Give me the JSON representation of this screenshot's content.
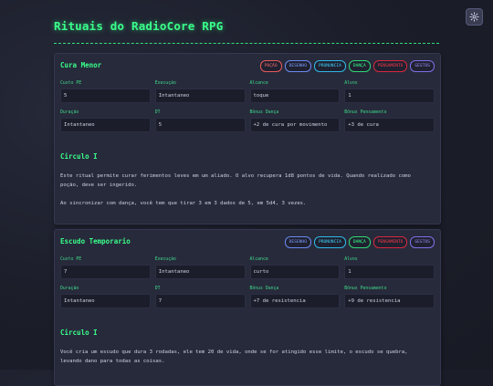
{
  "page_title": "Rituais do RadioCore RPG",
  "settings_icon": "gear-icon",
  "rituals": [
    {
      "name": "Cura Menor",
      "tags": [
        "POÇÃO",
        "DESENHO",
        "PRONUNCIA",
        "DANÇA",
        "PENSAMENTO",
        "GESTOS"
      ],
      "fields": [
        {
          "label": "Custo PE",
          "value": "5"
        },
        {
          "label": "Execução",
          "value": "Intantaneo"
        },
        {
          "label": "Alcance",
          "value": "toque"
        },
        {
          "label": "Alvos",
          "value": "1"
        },
        {
          "label": "Duração",
          "value": "Intantaneo"
        },
        {
          "label": "DT",
          "value": "5"
        },
        {
          "label": "Bônus Dança",
          "value": "+2 de cura por movimento"
        },
        {
          "label": "Bônus Pensamento",
          "value": "+3 de cura"
        }
      ],
      "circle": "Circulo I",
      "description": "Este ritual permite curar ferimentos leves em um aliado. O alvo recupera 1d8 pontos de vida. Quando realizado como poção, deve ser ingerido.",
      "note": "Ao sincronizar com dança, você tem que tirar 3 em 3 dados de 5, em 5d4, 3 vezes."
    },
    {
      "name": "Escudo Temporario",
      "tags": [
        "DESENHO",
        "PRONUNCIA",
        "DANÇA",
        "PENSAMENTO",
        "GESTOS"
      ],
      "fields": [
        {
          "label": "Custo PE",
          "value": "7"
        },
        {
          "label": "Execução",
          "value": "Intantaneo"
        },
        {
          "label": "Alcance",
          "value": "curto"
        },
        {
          "label": "Alvos",
          "value": "1"
        },
        {
          "label": "Duração",
          "value": "Intantaneo"
        },
        {
          "label": "DT",
          "value": "7"
        },
        {
          "label": "Bônus Dança",
          "value": "+7 de resistencia"
        },
        {
          "label": "Bônus Pensamento",
          "value": "+9 de resistencia"
        }
      ],
      "circle": "Circulo I",
      "description": "Você cria um escudo que dura 3 rodadas, ele tem 20 de vida, onde se for atingido esse limite, o escudo se quebra, levando dano para todas as coisas."
    }
  ]
}
